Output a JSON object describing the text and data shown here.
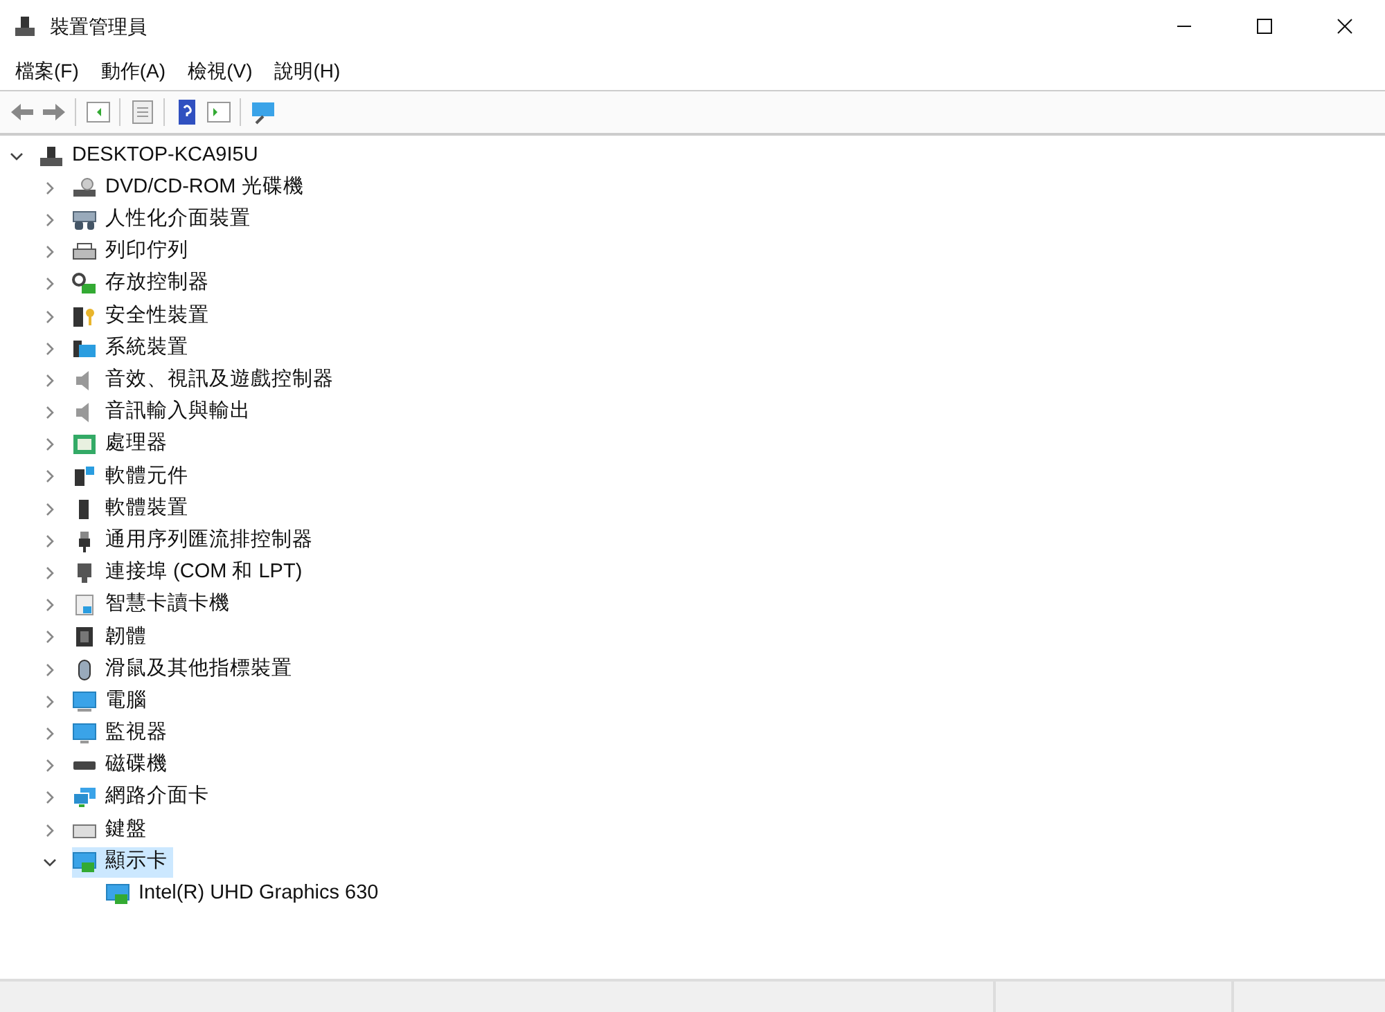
{
  "window": {
    "title": "裝置管理員"
  },
  "menu": [
    "檔案(F)",
    "動作(A)",
    "檢視(V)",
    "說明(H)"
  ],
  "tree": {
    "label": "DESKTOP-KCA9I5U",
    "expanded": true,
    "selected": false,
    "children": [
      {
        "label": "DVD/CD-ROM 光碟機",
        "expanded": false,
        "selected": false
      },
      {
        "label": "人性化介面裝置",
        "expanded": false,
        "selected": false
      },
      {
        "label": "列印佇列",
        "expanded": false,
        "selected": false
      },
      {
        "label": "存放控制器",
        "expanded": false,
        "selected": false
      },
      {
        "label": "安全性裝置",
        "expanded": false,
        "selected": false
      },
      {
        "label": "系統裝置",
        "expanded": false,
        "selected": false
      },
      {
        "label": "音效、視訊及遊戲控制器",
        "expanded": false,
        "selected": false
      },
      {
        "label": "音訊輸入與輸出",
        "expanded": false,
        "selected": false
      },
      {
        "label": "處理器",
        "expanded": false,
        "selected": false
      },
      {
        "label": "軟體元件",
        "expanded": false,
        "selected": false
      },
      {
        "label": "軟體裝置",
        "expanded": false,
        "selected": false
      },
      {
        "label": "通用序列匯流排控制器",
        "expanded": false,
        "selected": false
      },
      {
        "label": "連接埠 (COM 和 LPT)",
        "expanded": false,
        "selected": false
      },
      {
        "label": "智慧卡讀卡機",
        "expanded": false,
        "selected": false
      },
      {
        "label": "韌體",
        "expanded": false,
        "selected": false
      },
      {
        "label": "滑鼠及其他指標裝置",
        "expanded": false,
        "selected": false
      },
      {
        "label": "電腦",
        "expanded": false,
        "selected": false
      },
      {
        "label": "監視器",
        "expanded": false,
        "selected": false
      },
      {
        "label": "磁碟機",
        "expanded": false,
        "selected": false
      },
      {
        "label": "網路介面卡",
        "expanded": false,
        "selected": false
      },
      {
        "label": "鍵盤",
        "expanded": false,
        "selected": false
      },
      {
        "label": "顯示卡",
        "expanded": true,
        "selected": true,
        "children": [
          {
            "label": "Intel(R) UHD Graphics 630",
            "selected": false
          }
        ]
      }
    ]
  }
}
